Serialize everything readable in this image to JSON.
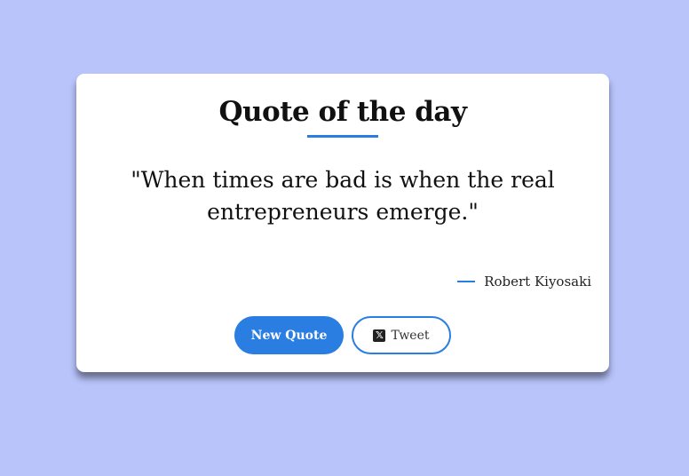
{
  "card": {
    "title": "Quote of the day",
    "quote": "\"When times are bad is when the real entrepreneurs emerge.\"",
    "author": "Robert Kiyosaki"
  },
  "buttons": {
    "new_quote_label": "New Quote",
    "tweet_label": "Tweet",
    "tweet_icon": "x-logo-icon"
  },
  "colors": {
    "background": "#b9c4fb",
    "accent": "#2a7de1",
    "card": "#ffffff"
  }
}
